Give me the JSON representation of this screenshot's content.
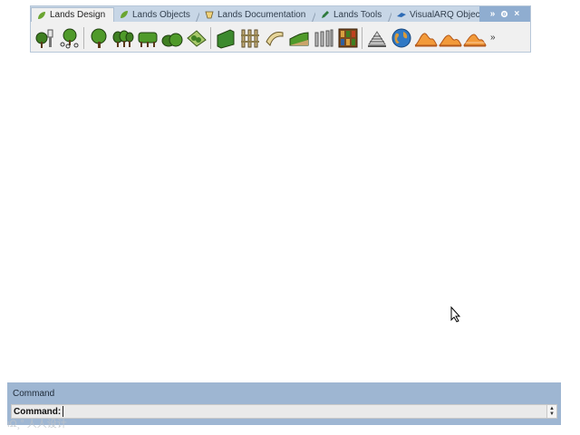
{
  "tabs": [
    {
      "label": "Lands Design",
      "active": true
    },
    {
      "label": "Lands Objects",
      "active": false
    },
    {
      "label": "Lands Documentation",
      "active": false
    },
    {
      "label": "Lands Tools",
      "active": false
    },
    {
      "label": "VisualARQ Objects",
      "active": false
    }
  ],
  "tab_controls": {
    "overflow": "»",
    "settings_icon": "gear-icon",
    "close": "×"
  },
  "toolbar_icons": [
    "tree-bush-icon",
    "group-plants-icon",
    "tree-icon",
    "row-of-trees-icon",
    "hedge-trees-icon",
    "shrubs-icon",
    "planting-area-icon",
    "wall-icon",
    "fence-icon",
    "path-icon",
    "terrain-slope-icon",
    "bollards-icon",
    "plant-library-icon",
    "elevation-profile-icon",
    "globe-icon",
    "terrain-icon",
    "terrain-modify-icon",
    "terrain-section-icon"
  ],
  "more_label": "»",
  "command": {
    "title": "Command",
    "prompt": "Command:",
    "value": ""
  },
  "watermark": "ιΩ¸° 人人设计"
}
